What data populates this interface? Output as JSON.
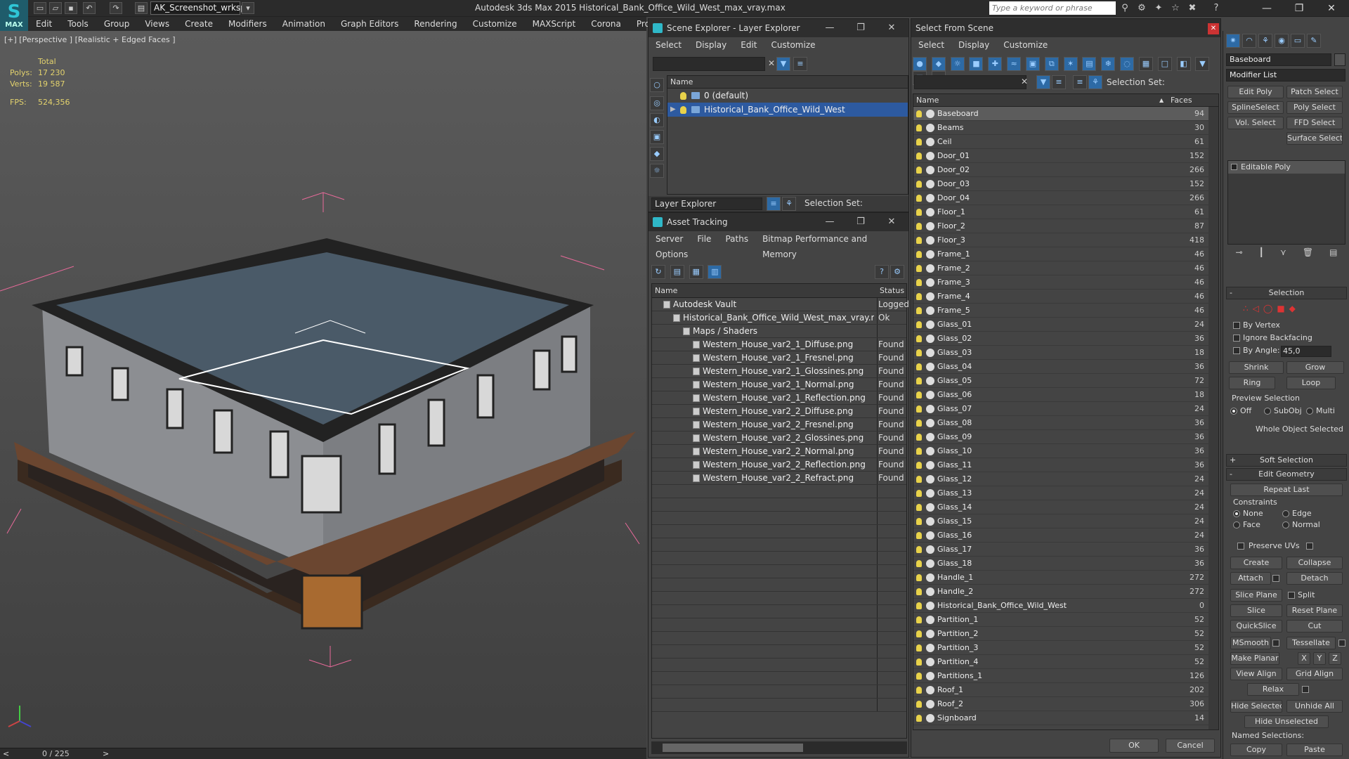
{
  "titlebar": {
    "logo_text": "MAX",
    "workspace": "AK_Screenshot_wrksp",
    "app_title": "Autodesk 3ds Max  2015     Historical_Bank_Office_Wild_West_max_vray.max",
    "search_placeholder": "Type a keyword or phrase",
    "minimize": "—",
    "maximize": "❐",
    "close": "✕"
  },
  "menubar": [
    "Edit",
    "Tools",
    "Group",
    "Views",
    "Create",
    "Modifiers",
    "Animation",
    "Graph Editors",
    "Rendering",
    "Customize",
    "MAXScript",
    "Corona",
    "Project Man"
  ],
  "viewport": {
    "label": "[+] [Perspective ] [Realistic + Edged Faces ]",
    "stats": {
      "total_label": "Total",
      "polys_label": "Polys:",
      "polys": "17 230",
      "verts_label": "Verts:",
      "verts": "19 587",
      "fps_label": "FPS:",
      "fps": "524,356"
    },
    "timeline": "0 / 225",
    "prev": "<",
    "next": ">"
  },
  "scene_explorer": {
    "title": "Scene Explorer - Layer Explorer",
    "menu": [
      "Select",
      "Display",
      "Edit",
      "Customize"
    ],
    "column": "Name",
    "layers": [
      {
        "name": "0 (default)",
        "selected": false
      },
      {
        "name": "Historical_Bank_Office_Wild_West",
        "selected": true
      }
    ],
    "footer_mode": "Layer Explorer",
    "selection_set_label": "Selection Set:"
  },
  "asset_tracking": {
    "title": "Asset Tracking",
    "menu": [
      "Server",
      "File",
      "Paths",
      "Bitmap Performance and Memory"
    ],
    "menu2": "Options",
    "col_name": "Name",
    "col_status": "Status",
    "rows": [
      {
        "name": "Autodesk Vault",
        "status": "Logged",
        "indent": 1
      },
      {
        "name": "Historical_Bank_Office_Wild_West_max_vray.max",
        "status": "Ok",
        "indent": 2
      },
      {
        "name": "Maps / Shaders",
        "status": "",
        "indent": 3
      },
      {
        "name": "Western_House_var2_1_Diffuse.png",
        "status": "Found",
        "indent": 4
      },
      {
        "name": "Western_House_var2_1_Fresnel.png",
        "status": "Found",
        "indent": 4
      },
      {
        "name": "Western_House_var2_1_Glossines.png",
        "status": "Found",
        "indent": 4
      },
      {
        "name": "Western_House_var2_1_Normal.png",
        "status": "Found",
        "indent": 4
      },
      {
        "name": "Western_House_var2_1_Reflection.png",
        "status": "Found",
        "indent": 4
      },
      {
        "name": "Western_House_var2_2_Diffuse.png",
        "status": "Found",
        "indent": 4
      },
      {
        "name": "Western_House_var2_2_Fresnel.png",
        "status": "Found",
        "indent": 4
      },
      {
        "name": "Western_House_var2_2_Glossines.png",
        "status": "Found",
        "indent": 4
      },
      {
        "name": "Western_House_var2_2_Normal.png",
        "status": "Found",
        "indent": 4
      },
      {
        "name": "Western_House_var2_2_Reflection.png",
        "status": "Found",
        "indent": 4
      },
      {
        "name": "Western_House_var2_2_Refract.png",
        "status": "Found",
        "indent": 4
      }
    ]
  },
  "select_from_scene": {
    "title": "Select From Scene",
    "menu": [
      "Select",
      "Display",
      "Customize"
    ],
    "selection_set_label": "Selection Set:",
    "col_name": "Name",
    "col_faces": "Faces",
    "objects": [
      {
        "name": "Baseboard",
        "faces": "94",
        "selected": true
      },
      {
        "name": "Beams",
        "faces": "30"
      },
      {
        "name": "Ceil",
        "faces": "61"
      },
      {
        "name": "Door_01",
        "faces": "152"
      },
      {
        "name": "Door_02",
        "faces": "266"
      },
      {
        "name": "Door_03",
        "faces": "152"
      },
      {
        "name": "Door_04",
        "faces": "266"
      },
      {
        "name": "Floor_1",
        "faces": "61"
      },
      {
        "name": "Floor_2",
        "faces": "87"
      },
      {
        "name": "Floor_3",
        "faces": "418"
      },
      {
        "name": "Frame_1",
        "faces": "46"
      },
      {
        "name": "Frame_2",
        "faces": "46"
      },
      {
        "name": "Frame_3",
        "faces": "46"
      },
      {
        "name": "Frame_4",
        "faces": "46"
      },
      {
        "name": "Frame_5",
        "faces": "46"
      },
      {
        "name": "Glass_01",
        "faces": "24"
      },
      {
        "name": "Glass_02",
        "faces": "36"
      },
      {
        "name": "Glass_03",
        "faces": "18"
      },
      {
        "name": "Glass_04",
        "faces": "36"
      },
      {
        "name": "Glass_05",
        "faces": "72"
      },
      {
        "name": "Glass_06",
        "faces": "18"
      },
      {
        "name": "Glass_07",
        "faces": "24"
      },
      {
        "name": "Glass_08",
        "faces": "36"
      },
      {
        "name": "Glass_09",
        "faces": "36"
      },
      {
        "name": "Glass_10",
        "faces": "36"
      },
      {
        "name": "Glass_11",
        "faces": "36"
      },
      {
        "name": "Glass_12",
        "faces": "24"
      },
      {
        "name": "Glass_13",
        "faces": "24"
      },
      {
        "name": "Glass_14",
        "faces": "24"
      },
      {
        "name": "Glass_15",
        "faces": "24"
      },
      {
        "name": "Glass_16",
        "faces": "24"
      },
      {
        "name": "Glass_17",
        "faces": "36"
      },
      {
        "name": "Glass_18",
        "faces": "36"
      },
      {
        "name": "Handle_1",
        "faces": "272"
      },
      {
        "name": "Handle_2",
        "faces": "272"
      },
      {
        "name": "Historical_Bank_Office_Wild_West",
        "faces": "0"
      },
      {
        "name": "Partition_1",
        "faces": "52"
      },
      {
        "name": "Partition_2",
        "faces": "52"
      },
      {
        "name": "Partition_3",
        "faces": "52"
      },
      {
        "name": "Partition_4",
        "faces": "52"
      },
      {
        "name": "Partitions_1",
        "faces": "126"
      },
      {
        "name": "Roof_1",
        "faces": "202"
      },
      {
        "name": "Roof_2",
        "faces": "306"
      },
      {
        "name": "Signboard",
        "faces": "14"
      }
    ],
    "ok": "OK",
    "cancel": "Cancel"
  },
  "command_panel": {
    "object_name": "Baseboard",
    "modifier_list": "Modifier List",
    "mod_buttons": [
      "Edit Poly",
      "Patch Select",
      "SplineSelect",
      "Poly Select",
      "Vol. Select",
      "FFD Select",
      "Surface Select"
    ],
    "stack_item": "Editable Poly",
    "selection": {
      "title": "Selection",
      "by_vertex": "By Vertex",
      "ignore_backfacing": "Ignore Backfacing",
      "by_angle": "By Angle:",
      "angle_value": "45,0",
      "shrink": "Shrink",
      "grow": "Grow",
      "ring": "Ring",
      "loop": "Loop",
      "preview_title": "Preview Selection",
      "off": "Off",
      "subobj": "SubObj",
      "multi": "Multi",
      "status": "Whole Object Selected"
    },
    "soft_selection": "Soft Selection",
    "edit_geometry": {
      "title": "Edit Geometry",
      "repeat_last": "Repeat Last",
      "constraints": "Constraints",
      "none": "None",
      "edge": "Edge",
      "face": "Face",
      "normal": "Normal",
      "preserve_uvs": "Preserve UVs",
      "create": "Create",
      "collapse": "Collapse",
      "attach": "Attach",
      "detach": "Detach",
      "slice_plane": "Slice Plane",
      "split": "Split",
      "slice": "Slice",
      "reset_plane": "Reset Plane",
      "quickslice": "QuickSlice",
      "cut": "Cut",
      "msmooth": "MSmooth",
      "tessellate": "Tessellate",
      "make_planar": "Make Planar",
      "x": "X",
      "y": "Y",
      "z": "Z",
      "view_align": "View Align",
      "grid_align": "Grid Align",
      "relax": "Relax",
      "hide_selected": "Hide Selected",
      "unhide_all": "Unhide All",
      "hide_unselected": "Hide Unselected",
      "named_selections": "Named Selections:",
      "copy": "Copy",
      "paste": "Paste"
    }
  }
}
